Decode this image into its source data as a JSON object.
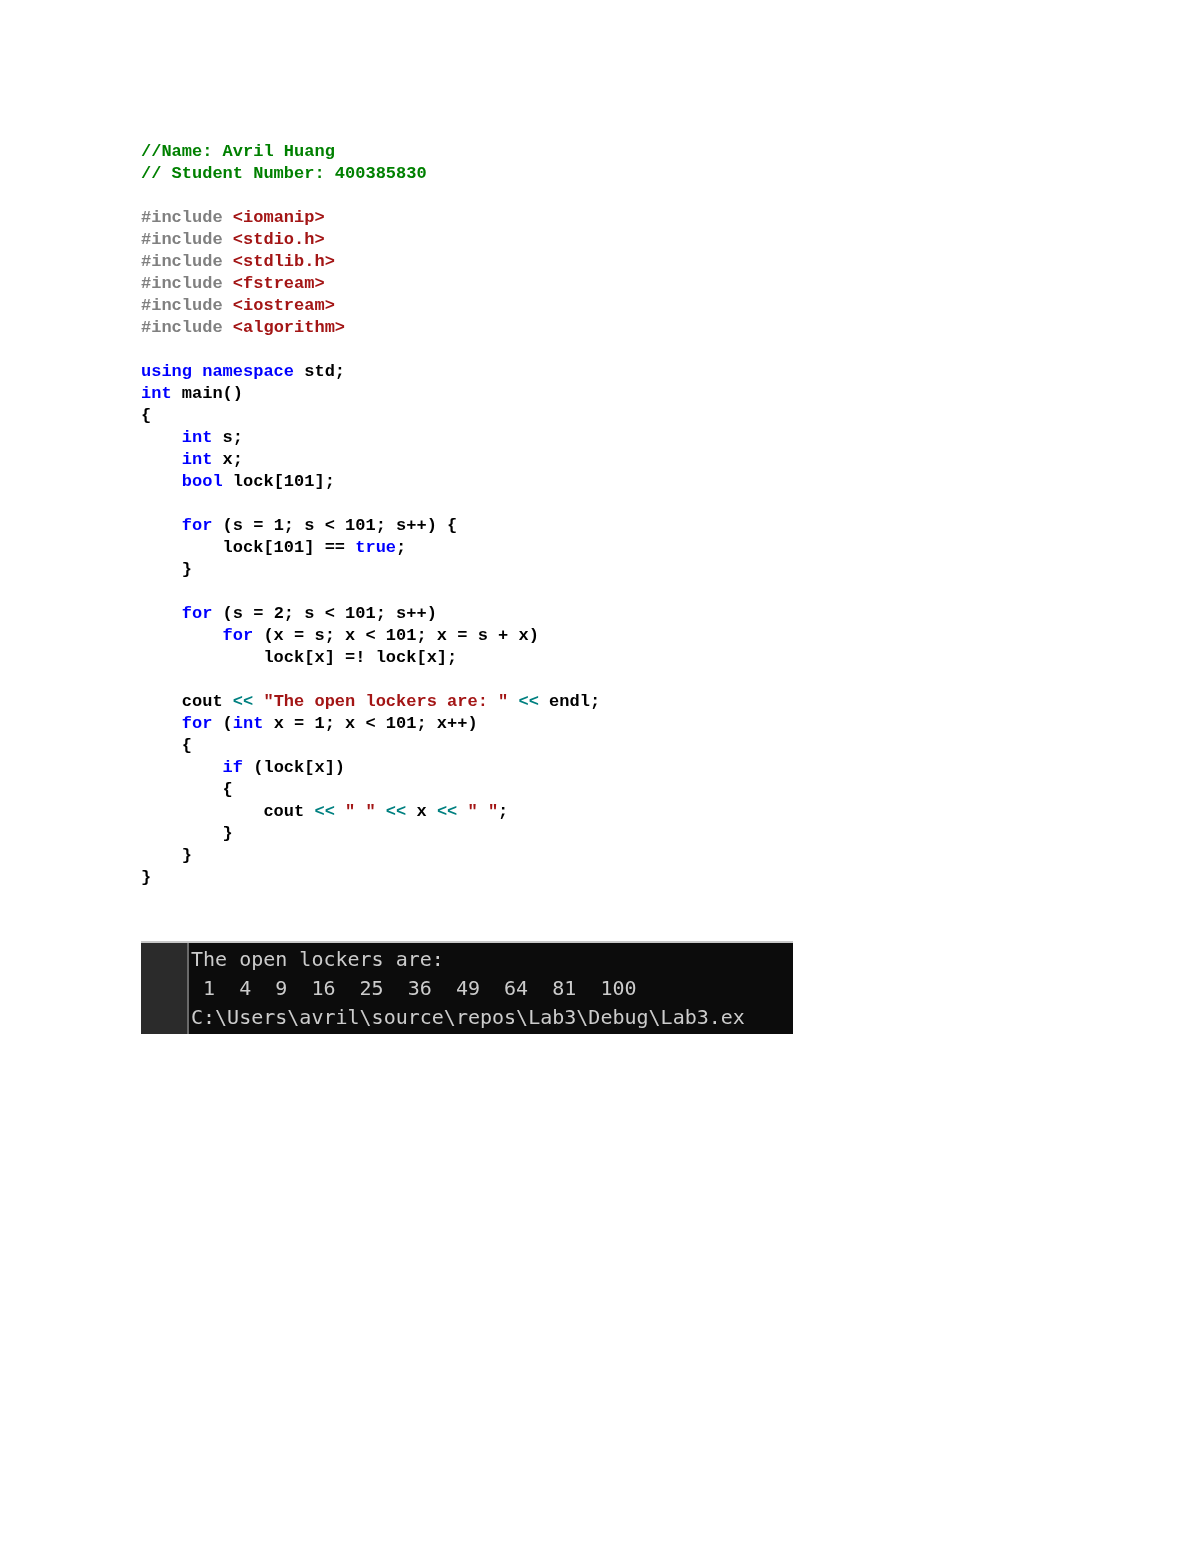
{
  "code": {
    "blocks": [
      [
        [
          {
            "kind": "comment",
            "text": "//Name: Avril Huang"
          }
        ],
        [
          {
            "kind": "comment",
            "text": "// Student Number: 400385830"
          }
        ]
      ],
      [
        [
          {
            "kind": "preproc",
            "text": "#include "
          },
          {
            "kind": "string",
            "text": "<iomanip>"
          }
        ],
        [
          {
            "kind": "preproc",
            "text": "#include "
          },
          {
            "kind": "string",
            "text": "<stdio.h>"
          }
        ],
        [
          {
            "kind": "preproc",
            "text": "#include "
          },
          {
            "kind": "string",
            "text": "<stdlib.h>"
          }
        ],
        [
          {
            "kind": "preproc",
            "text": "#include "
          },
          {
            "kind": "string",
            "text": "<fstream>"
          }
        ],
        [
          {
            "kind": "preproc",
            "text": "#include "
          },
          {
            "kind": "string",
            "text": "<iostream>"
          }
        ],
        [
          {
            "kind": "preproc",
            "text": "#include "
          },
          {
            "kind": "string",
            "text": "<algorithm>"
          }
        ]
      ],
      [
        [
          {
            "kind": "keyword",
            "text": "using namespace"
          },
          {
            "kind": "plain",
            "text": " std;"
          }
        ],
        [
          {
            "kind": "keyword",
            "text": "int"
          },
          {
            "kind": "plain",
            "text": " main()"
          }
        ],
        [
          {
            "kind": "plain",
            "text": "{"
          }
        ],
        [
          {
            "kind": "keyword",
            "text": "    int"
          },
          {
            "kind": "plain",
            "text": " s;"
          }
        ],
        [
          {
            "kind": "keyword",
            "text": "    int"
          },
          {
            "kind": "plain",
            "text": " x;"
          }
        ],
        [
          {
            "kind": "keyword",
            "text": "    bool"
          },
          {
            "kind": "plain",
            "text": " lock[101];"
          }
        ]
      ],
      [
        [
          {
            "kind": "keyword",
            "text": "    for"
          },
          {
            "kind": "plain",
            "text": " (s = 1; s < 101; s++) {"
          }
        ],
        [
          {
            "kind": "plain",
            "text": "        lock[101] == "
          },
          {
            "kind": "keyword",
            "text": "true"
          },
          {
            "kind": "plain",
            "text": ";"
          }
        ],
        [
          {
            "kind": "plain",
            "text": "    }"
          }
        ]
      ],
      [
        [
          {
            "kind": "keyword",
            "text": "    for"
          },
          {
            "kind": "plain",
            "text": " (s = 2; s < 101; s++)"
          }
        ],
        [
          {
            "kind": "keyword",
            "text": "        for"
          },
          {
            "kind": "plain",
            "text": " (x = s; x < 101; x = s + x)"
          }
        ],
        [
          {
            "kind": "plain",
            "text": "            lock[x] =! lock[x];"
          }
        ]
      ],
      [
        [
          {
            "kind": "plain",
            "text": "    cout "
          },
          {
            "kind": "operator",
            "text": "<<"
          },
          {
            "kind": "string",
            "text": " \"The open lockers are: \""
          },
          {
            "kind": "operator",
            "text": " <<"
          },
          {
            "kind": "plain",
            "text": " endl;"
          }
        ],
        [
          {
            "kind": "keyword",
            "text": "    for"
          },
          {
            "kind": "plain",
            "text": " ("
          },
          {
            "kind": "keyword",
            "text": "int"
          },
          {
            "kind": "plain",
            "text": " x = 1; x < 101; x++)"
          }
        ],
        [
          {
            "kind": "plain",
            "text": "    {"
          }
        ],
        [
          {
            "kind": "keyword",
            "text": "        if"
          },
          {
            "kind": "plain",
            "text": " (lock[x])"
          }
        ],
        [
          {
            "kind": "plain",
            "text": "        {"
          }
        ],
        [
          {
            "kind": "plain",
            "text": "            cout "
          },
          {
            "kind": "operator",
            "text": "<<"
          },
          {
            "kind": "string",
            "text": " \" \" "
          },
          {
            "kind": "operator",
            "text": "<<"
          },
          {
            "kind": "plain",
            "text": " x "
          },
          {
            "kind": "operator",
            "text": "<<"
          },
          {
            "kind": "string",
            "text": " \" \""
          },
          {
            "kind": "plain",
            "text": ";"
          }
        ],
        [
          {
            "kind": "plain",
            "text": "        }"
          }
        ],
        [
          {
            "kind": "plain",
            "text": "    }"
          }
        ],
        [
          {
            "kind": "plain",
            "text": "}"
          }
        ]
      ]
    ]
  },
  "console": {
    "lines": [
      "The open lockers are:",
      " 1  4  9  16  25  36  49  64  81  100",
      "C:\\Users\\avril\\source\\repos\\Lab3\\Debug\\Lab3.ex"
    ]
  }
}
